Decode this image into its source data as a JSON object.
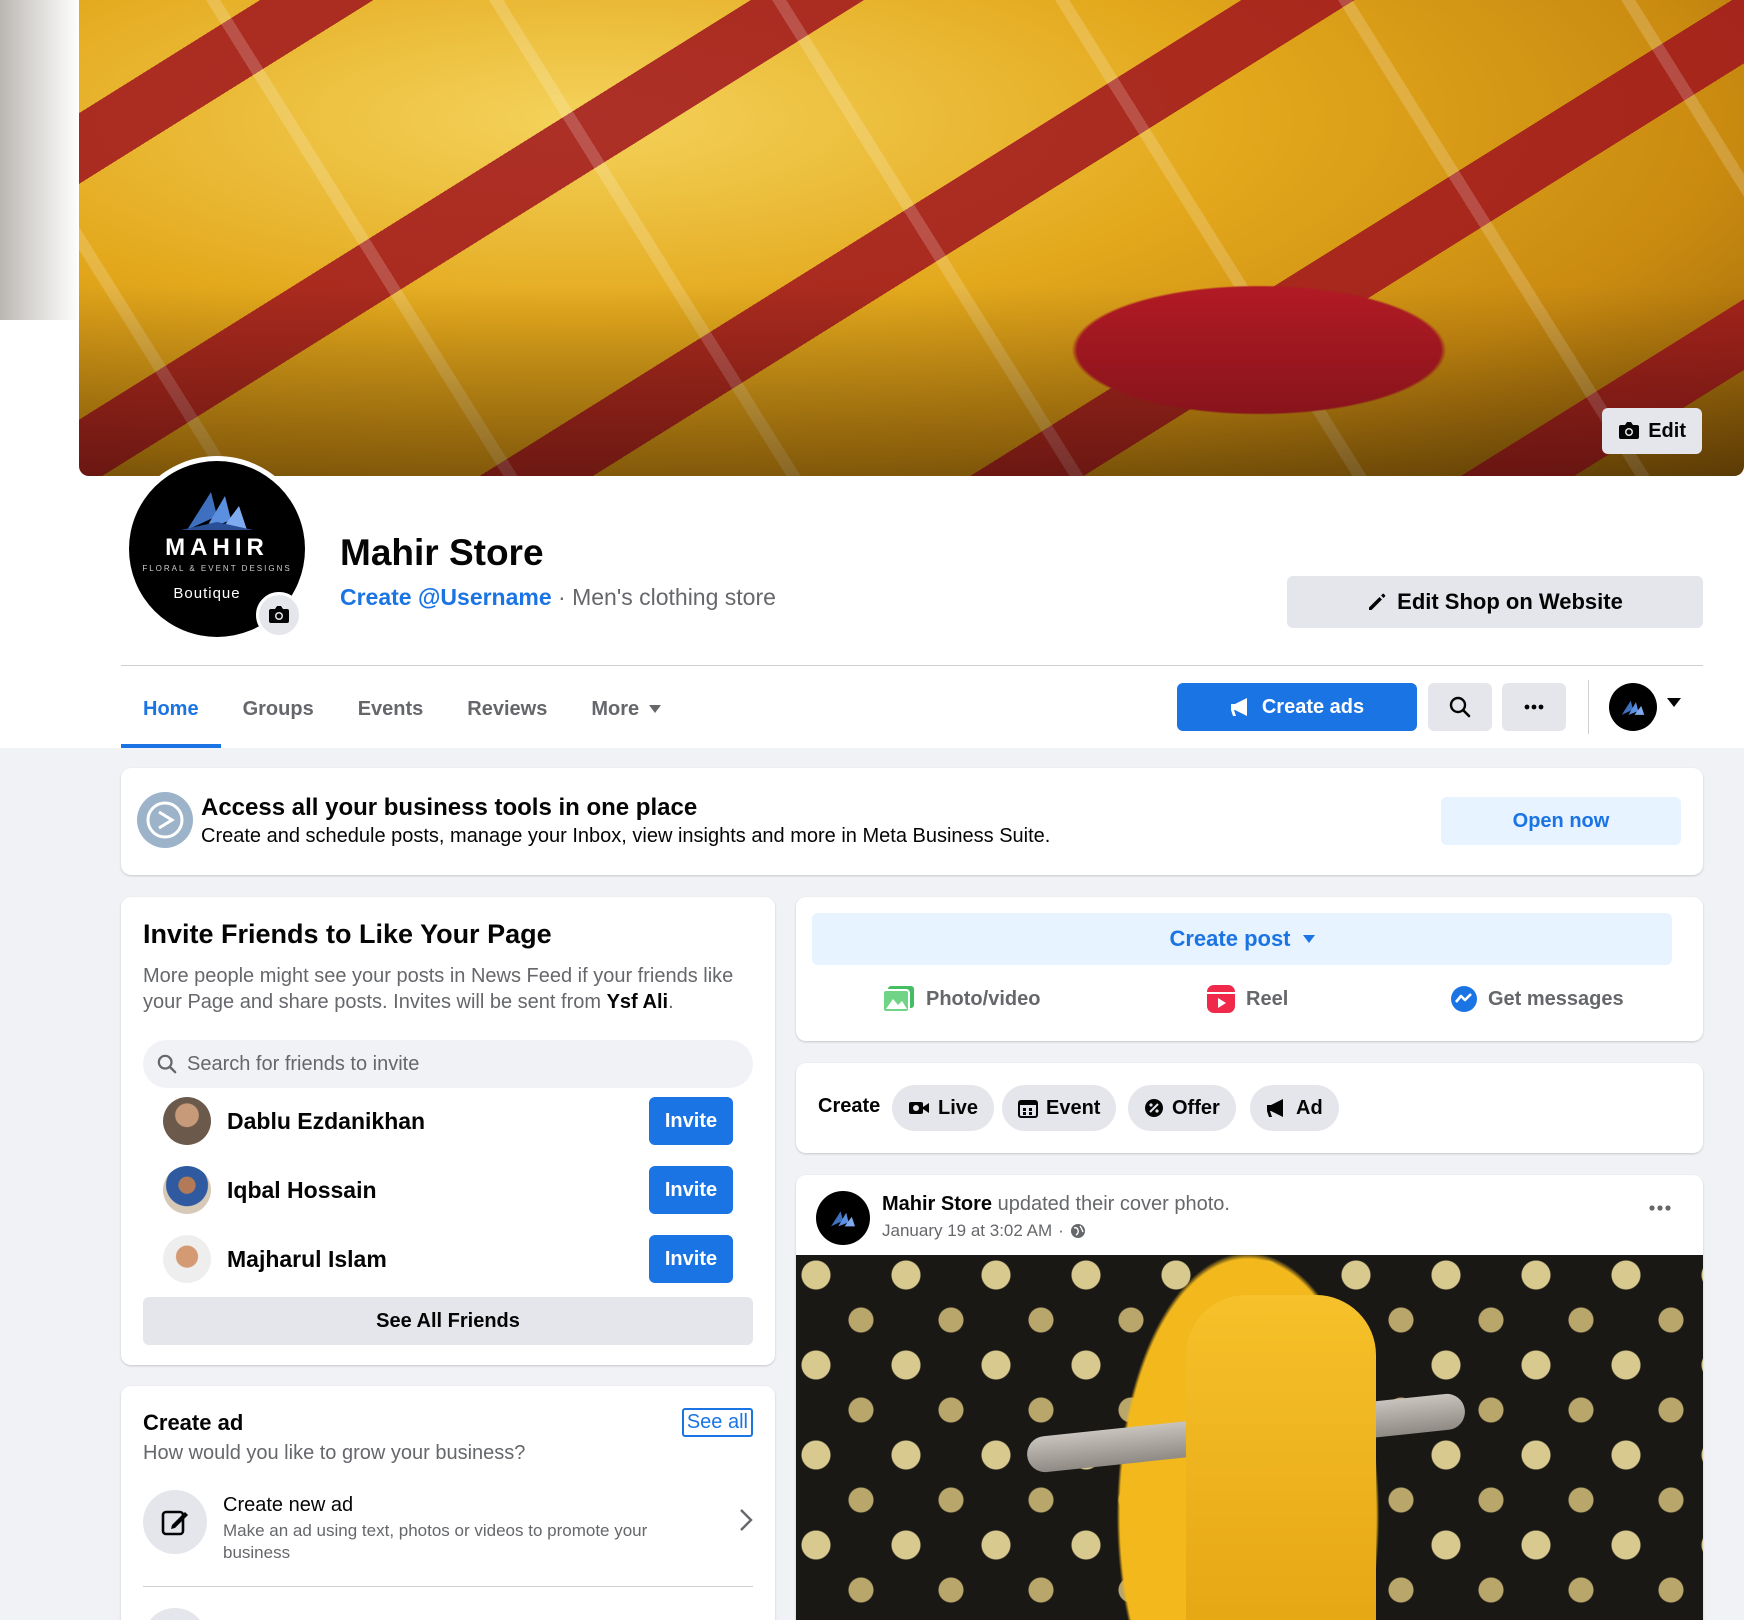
{
  "cover": {
    "edit_label": "Edit"
  },
  "profile": {
    "logo_word": "MAHIR",
    "logo_tagline": "FLORAL & EVENT DESIGNS",
    "logo_sub": "Boutique",
    "name": "Mahir Store",
    "username_link": "Create @Username",
    "separator": " · ",
    "category": "Men's clothing store",
    "edit_shop_label": "Edit Shop on Website"
  },
  "tabs": [
    {
      "label": "Home",
      "active": true
    },
    {
      "label": "Groups"
    },
    {
      "label": "Events"
    },
    {
      "label": "Reviews"
    },
    {
      "label": "More"
    }
  ],
  "actions": {
    "create_ads_label": "Create ads"
  },
  "banner": {
    "title": "Access all your business tools in one place",
    "description": "Create and schedule posts, manage your Inbox, view insights and more in Meta Business Suite.",
    "button_label": "Open now"
  },
  "invite": {
    "title": "Invite Friends to Like Your Page",
    "description_prefix": "More people might see your posts in News Feed if your friends like your Page and share posts. Invites will be sent from ",
    "sender": "Ysf Ali",
    "description_suffix": ".",
    "search_placeholder": "Search for friends to invite",
    "friends": [
      {
        "name": "Dablu Ezdanikhan",
        "button": "Invite"
      },
      {
        "name": "Iqbal Hossain",
        "button": "Invite"
      },
      {
        "name": "Majharul Islam",
        "button": "Invite"
      }
    ],
    "see_all_label": "See All Friends"
  },
  "create_ad": {
    "title": "Create ad",
    "see_all": "See all",
    "subtitle": "How would you like to grow your business?",
    "item_title": "Create new ad",
    "item_desc": "Make an ad using text, photos or videos to promote your business"
  },
  "create_post": {
    "button_label": "Create post",
    "options": [
      "Photo/video",
      "Reel",
      "Get messages"
    ]
  },
  "create_row": {
    "label": "Create",
    "chips": [
      "Live",
      "Event",
      "Offer",
      "Ad"
    ]
  },
  "post": {
    "author": "Mahir Store",
    "action": " updated their cover photo.",
    "timestamp": "January 19 at 3:02 AM",
    "meta_sep": " · "
  },
  "colors": {
    "accent": "#1b74e4",
    "accent_light": "#e7f3ff",
    "button_gray": "#e4e6eb",
    "page_bg": "#f0f2f5"
  }
}
